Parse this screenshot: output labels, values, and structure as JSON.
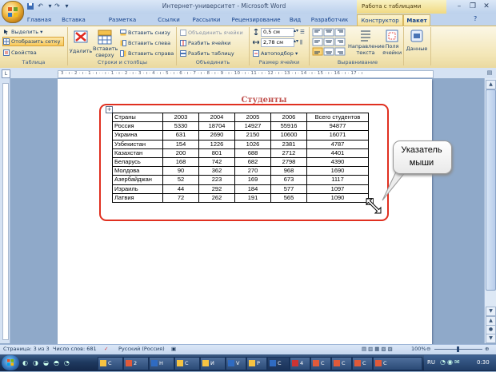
{
  "window": {
    "title": "Интернет-университет - Microsoft Word",
    "context_tools": "Работа с таблицами"
  },
  "tabs": [
    "Главная",
    "Вставка",
    "Разметка страницы",
    "Ссылки",
    "Рассылки",
    "Рецензирование",
    "Вид",
    "Разработчик",
    "Конструктор",
    "Макет"
  ],
  "ribbon": {
    "table": {
      "select": "Выделить",
      "show_grid": "Отобразить сетку",
      "properties": "Свойства",
      "label": "Таблица"
    },
    "rows_cols": {
      "delete": "Удалить",
      "insert_above": "Вставить сверху",
      "insert_below": "Вставить снизу",
      "insert_left": "Вставить слева",
      "insert_right": "Вставить справа",
      "label": "Строки и столбцы"
    },
    "merge": {
      "merge_cells": "Объединить ячейки",
      "split_cells": "Разбить ячейки",
      "split_table": "Разбить таблицу",
      "label": "Объединить"
    },
    "cell_size": {
      "height": "0,5 см",
      "width": "2,78 см",
      "autofit": "Автоподбор",
      "label": "Размер ячейки"
    },
    "alignment": {
      "text_direction": "Направление текста",
      "cell_margins": "Поля ячейки",
      "label": "Выравнивание"
    },
    "data": {
      "label": "Данные"
    }
  },
  "ruler_text": "· 3 · ı · 2 · ı · 1 · ı ·   · ı · 1 · ı · 2 · ı · 3 · ı · 4 · ı · 5 · ı · 6 · ı · 7 · ı · 8 · ı · 9 · ı · 10 · ı · 11 · ı · 12 · ı · 13 · ı · 14 · ı · 15 · ı · 16 · ı · 17 · ı",
  "document": {
    "heading": "Студенты",
    "table": {
      "headers": [
        "Страны",
        "2003",
        "2004",
        "2005",
        "2006",
        "Всего студентов"
      ],
      "rows": [
        [
          "Россия",
          "5330",
          "18704",
          "14927",
          "55916",
          "94877"
        ],
        [
          "Украина",
          "631",
          "2690",
          "2150",
          "10600",
          "16071"
        ],
        [
          "Узбекистан",
          "154",
          "1226",
          "1026",
          "2381",
          "4787"
        ],
        [
          "Казахстан",
          "200",
          "801",
          "688",
          "2712",
          "4401"
        ],
        [
          "Беларусь",
          "168",
          "742",
          "682",
          "2798",
          "4390"
        ],
        [
          "Молдова",
          "90",
          "362",
          "270",
          "968",
          "1690"
        ],
        [
          "Азербайджан",
          "52",
          "223",
          "169",
          "673",
          "1117"
        ],
        [
          "Израиль",
          "44",
          "292",
          "184",
          "577",
          "1097"
        ],
        [
          "Латвия",
          "72",
          "262",
          "191",
          "565",
          "1090"
        ]
      ]
    }
  },
  "callout": {
    "line1": "Указатель",
    "line2": "мыши"
  },
  "status": {
    "page": "Страница: 3 из 3",
    "words": "Число слов: 681",
    "language": "Русский (Россия)",
    "zoom": "100%"
  },
  "taskbar": {
    "lang": "RU",
    "clock": "0:30",
    "tasks": [
      "С",
      "2",
      "Н",
      "С",
      "И",
      "V",
      "Р",
      "С",
      "4",
      "С",
      "С",
      "С",
      "С"
    ]
  }
}
